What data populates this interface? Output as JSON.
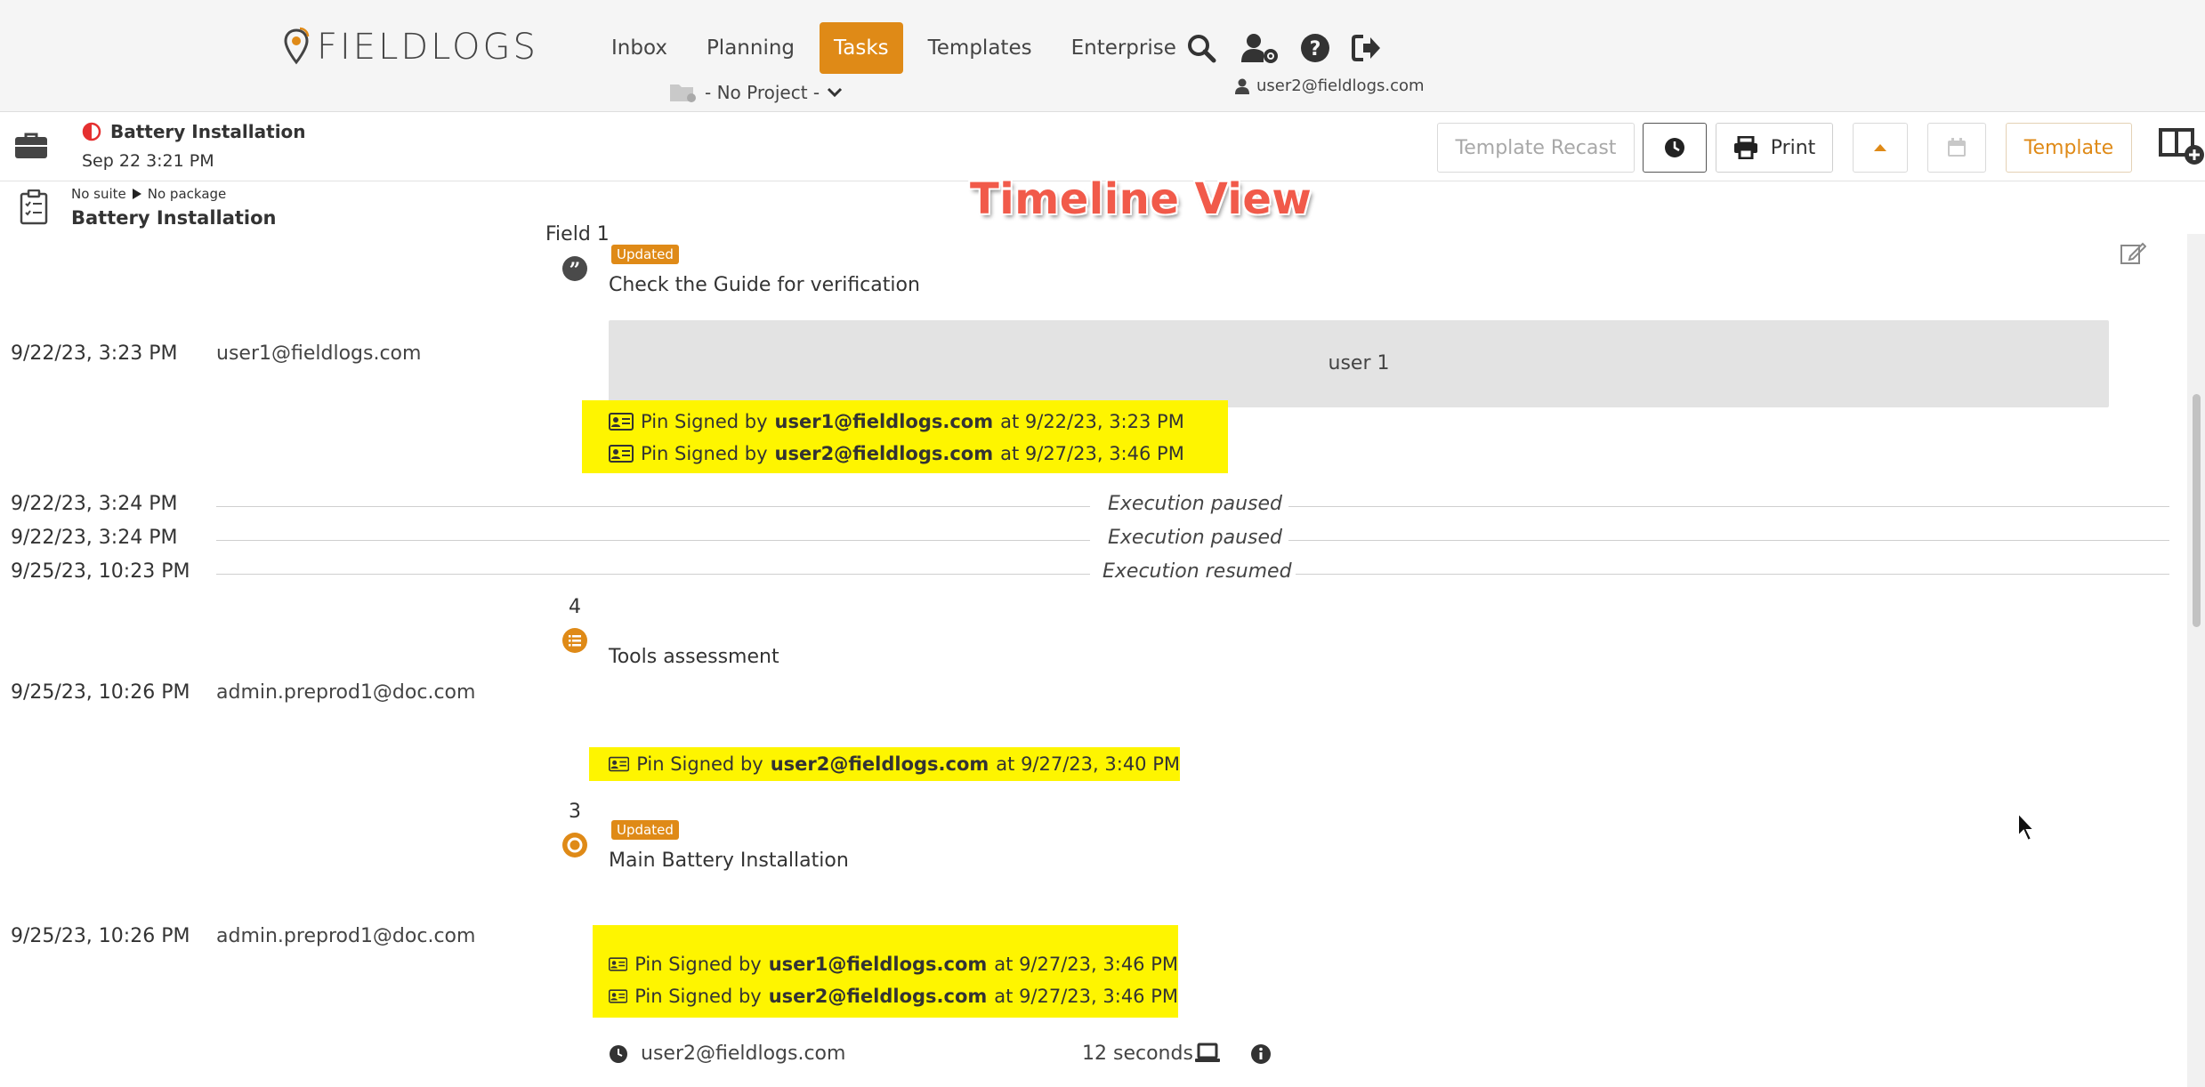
{
  "brand": {
    "name": "FIELDLOGS"
  },
  "nav": {
    "items": [
      "Inbox",
      "Planning",
      "Tasks",
      "Templates",
      "Enterprise"
    ],
    "active": "Tasks"
  },
  "project": {
    "label": "- No Project -"
  },
  "current_user": "user2@fieldlogs.com",
  "task": {
    "title": "Battery Installation",
    "date": "Sep 22 3:21 PM"
  },
  "toolbar": {
    "template_recast": "Template Recast",
    "print": "Print",
    "template": "Template"
  },
  "subheader": {
    "suite": "No suite",
    "package": "No package",
    "name": "Battery Installation"
  },
  "annotation": "Timeline View",
  "timeline": {
    "field1": {
      "label": "Field 1",
      "badge": "Updated",
      "title": "Check the Guide for verification",
      "timestamp": "9/22/23, 3:23 PM",
      "user": "user1@fieldlogs.com",
      "value": "user 1",
      "signatures": [
        {
          "prefix": "Pin Signed by",
          "user": "user1@fieldlogs.com",
          "at": "at 9/22/23, 3:23 PM"
        },
        {
          "prefix": "Pin Signed by",
          "user": "user2@fieldlogs.com",
          "at": "at 9/27/23, 3:46 PM"
        }
      ]
    },
    "events": [
      {
        "timestamp": "9/22/23, 3:24 PM",
        "text": "Execution paused"
      },
      {
        "timestamp": "9/22/23, 3:24 PM",
        "text": "Execution paused"
      },
      {
        "timestamp": "9/25/23, 10:23 PM",
        "text": "Execution resumed"
      }
    ],
    "step4": {
      "number": "4",
      "title": "Tools assessment",
      "timestamp": "9/25/23, 10:26 PM",
      "user": "admin.preprod1@doc.com",
      "signatures": [
        {
          "prefix": "Pin Signed by",
          "user": "user2@fieldlogs.com",
          "at": "at 9/27/23, 3:40 PM"
        }
      ]
    },
    "step3": {
      "number": "3",
      "badge": "Updated",
      "title": "Main Battery Installation",
      "timestamp": "9/25/23, 10:26 PM",
      "user": "admin.preprod1@doc.com",
      "signatures": [
        {
          "prefix": "Pin Signed by",
          "user": "user1@fieldlogs.com",
          "at": "at 9/27/23, 3:46 PM"
        },
        {
          "prefix": "Pin Signed by",
          "user": "user2@fieldlogs.com",
          "at": "at 9/27/23, 3:46 PM"
        }
      ]
    },
    "footer": {
      "user": "user2@fieldlogs.com",
      "duration": "12 seconds"
    }
  },
  "colors": {
    "accent": "#df8a17",
    "highlight": "#fef500",
    "annotation": "#f15a4a"
  }
}
